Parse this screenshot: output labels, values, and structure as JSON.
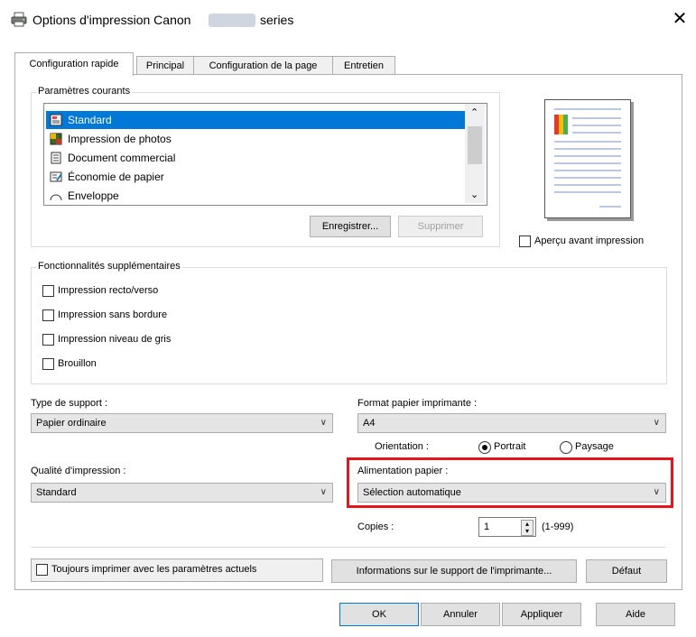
{
  "window": {
    "title_prefix": "Options d'impression Canon",
    "title_suffix": "series",
    "close_glyph": "✕"
  },
  "tabs": [
    {
      "label": "Configuration rapide",
      "active": true
    },
    {
      "label": "Principal",
      "active": false
    },
    {
      "label": "Configuration de la page",
      "active": false
    },
    {
      "label": "Entretien",
      "active": false
    }
  ],
  "current_settings": {
    "legend": "Paramètres courants",
    "items": [
      {
        "label": "Standard",
        "icon": "standard-doc-icon",
        "selected": true
      },
      {
        "label": "Impression de photos",
        "icon": "photo-icon",
        "selected": false
      },
      {
        "label": "Document commercial",
        "icon": "business-doc-icon",
        "selected": false
      },
      {
        "label": "Économie de papier",
        "icon": "paper-saving-icon",
        "selected": false
      },
      {
        "label": "Enveloppe",
        "icon": "envelope-icon",
        "selected": false
      }
    ],
    "save_label": "Enregistrer...",
    "delete_label": "Supprimer"
  },
  "preview": {
    "label": "Aperçu avant impression",
    "checked": false
  },
  "additional_features": {
    "legend": "Fonctionnalités supplémentaires",
    "items": [
      {
        "label": "Impression recto/verso",
        "checked": false
      },
      {
        "label": "Impression sans bordure",
        "checked": false
      },
      {
        "label": "Impression niveau de gris",
        "checked": false
      },
      {
        "label": "Brouillon",
        "checked": false
      }
    ]
  },
  "media_type": {
    "label": "Type de support :",
    "value": "Papier ordinaire"
  },
  "printer_paper_size": {
    "label": "Format papier imprimante :",
    "value": "A4"
  },
  "orientation": {
    "label": "Orientation :",
    "portrait": "Portrait",
    "landscape": "Paysage",
    "selected": "Portrait"
  },
  "print_quality": {
    "label": "Qualité d'impression :",
    "value": "Standard"
  },
  "paper_source": {
    "label": "Alimentation papier :",
    "value": "Sélection automatique",
    "highlight_color": "#e8141c"
  },
  "copies": {
    "label": "Copies :",
    "value": "1",
    "range": "(1-999)"
  },
  "always_print": {
    "label": "Toujours imprimer avec les paramètres actuels",
    "checked": false
  },
  "media_info_button": "Informations sur le support de l'imprimante...",
  "defaults_button": "Défaut",
  "footer": {
    "ok": "OK",
    "cancel": "Annuler",
    "apply": "Appliquer",
    "help": "Aide"
  },
  "colors": {
    "selection": "#0078d7",
    "highlight": "#e8141c"
  }
}
